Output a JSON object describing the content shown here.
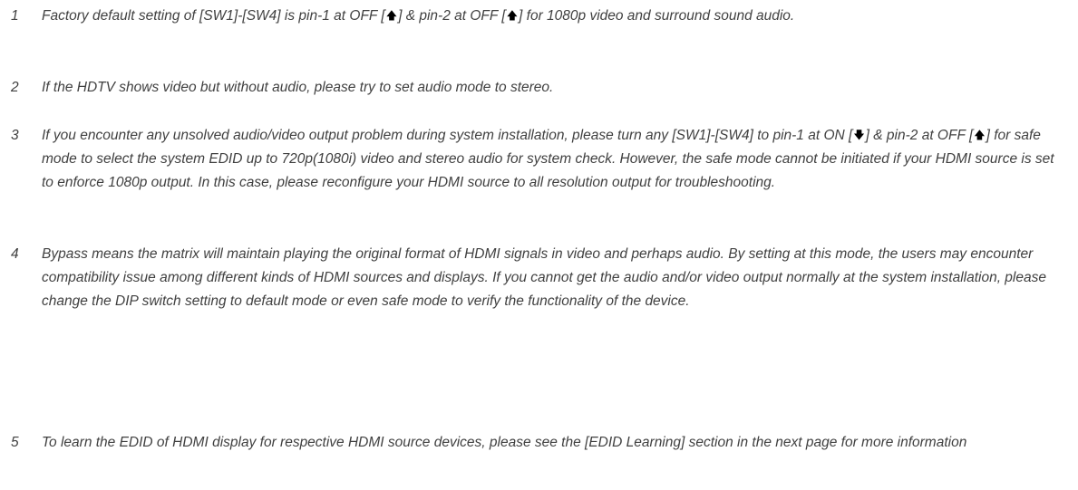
{
  "icons": {
    "up": "up-arrow-icon",
    "down": "down-arrow-icon"
  },
  "notes": [
    {
      "number": "1",
      "parts": [
        "Factory default setting of [SW1]-[SW4] is pin-1 at OFF [",
        "] & pin-2 at OFF [",
        "] for 1080p video and surround sound audio."
      ]
    },
    {
      "number": "2",
      "text": "If the HDTV shows video but without audio, please try to set audio mode to stereo."
    },
    {
      "number": "3",
      "parts": [
        "If you encounter any unsolved audio/video output problem during system installation, please turn any [SW1]-[SW4] to pin-1 at ON [",
        "] & pin-2 at OFF [",
        "] for safe mode to select the system EDID up to 720p(1080i) video and stereo audio for system check. However, the safe mode cannot be initiated if your HDMI source is set to enforce 1080p output. In this case, please reconfigure your HDMI source to all resolution output for troubleshooting."
      ]
    },
    {
      "number": "4",
      "text": "Bypass means the matrix will maintain playing the original format of HDMI signals in video and perhaps audio. By setting at this mode, the users may encounter compatibility issue among different kinds of HDMI sources and displays. If you cannot get the audio and/or video output normally at the system installation, please change the DIP switch setting to default mode or even safe mode to verify the functionality of the device."
    },
    {
      "number": "5",
      "text": "To learn the EDID of HDMI display for respective HDMI source devices, please see the [EDID Learning] section in the next page for more information"
    }
  ]
}
